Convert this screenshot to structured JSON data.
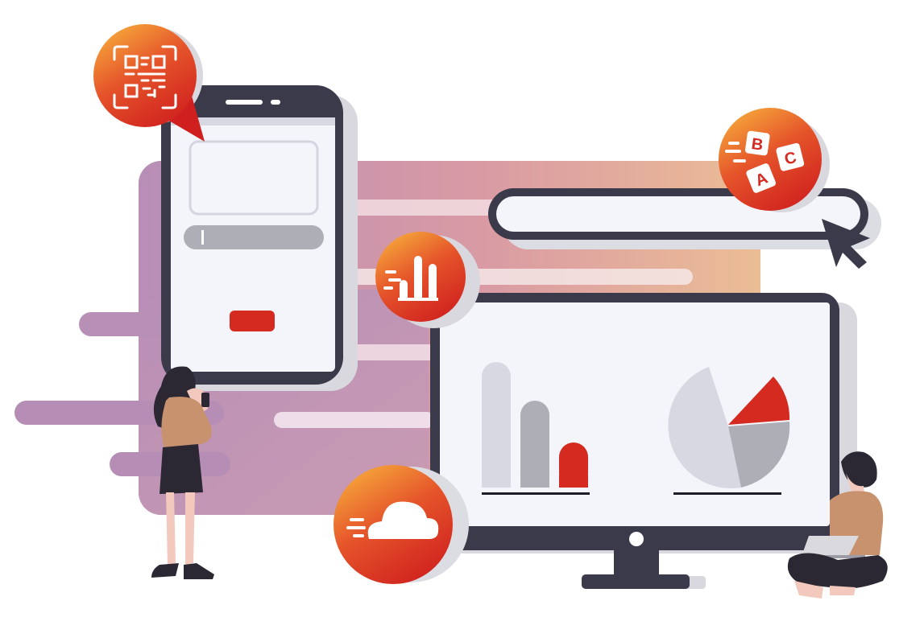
{
  "scene": {
    "letters": {
      "b": "B",
      "c": "C",
      "a": "A"
    },
    "colors": {
      "accent_red": "#d42a1f",
      "accent_orange": "#f5a33a",
      "device_dark": "#3a3a4a",
      "screen_bg": "#f4f5fa",
      "band_purple": "#b98fb6",
      "band_peach": "#e9b59a",
      "gray_light": "#d7d8e2",
      "gray_mid": "#adaeb6"
    },
    "icons": {
      "qr": "qr-code-scan-icon",
      "abc": "alphabet-blocks-icon",
      "chart": "bar-chart-icon",
      "cloud": "cloud-icon",
      "cursor": "mouse-pointer-icon"
    }
  }
}
